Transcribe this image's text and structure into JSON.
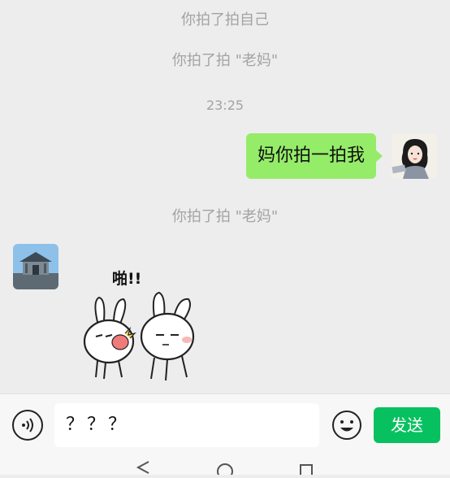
{
  "messages": {
    "sys1": "你拍了拍自己",
    "sys2": "你拍了拍 \"老妈\"",
    "time": "23:25",
    "outgoing_text": "妈你拍一拍我",
    "sys3": "你拍了拍 \"老妈\"",
    "sticker_caption": "啪!!"
  },
  "input": {
    "value": "？？？",
    "send_label": "发送"
  },
  "icons": {
    "voice": "voice-icon",
    "emoji": "emoji-icon",
    "back": "nav-back-icon",
    "home": "nav-home-icon",
    "recents": "nav-recents-icon"
  },
  "colors": {
    "background": "#ededed",
    "bubble_outgoing": "#95ec69",
    "send_button": "#07c160",
    "system_text": "#a3a3a3"
  }
}
